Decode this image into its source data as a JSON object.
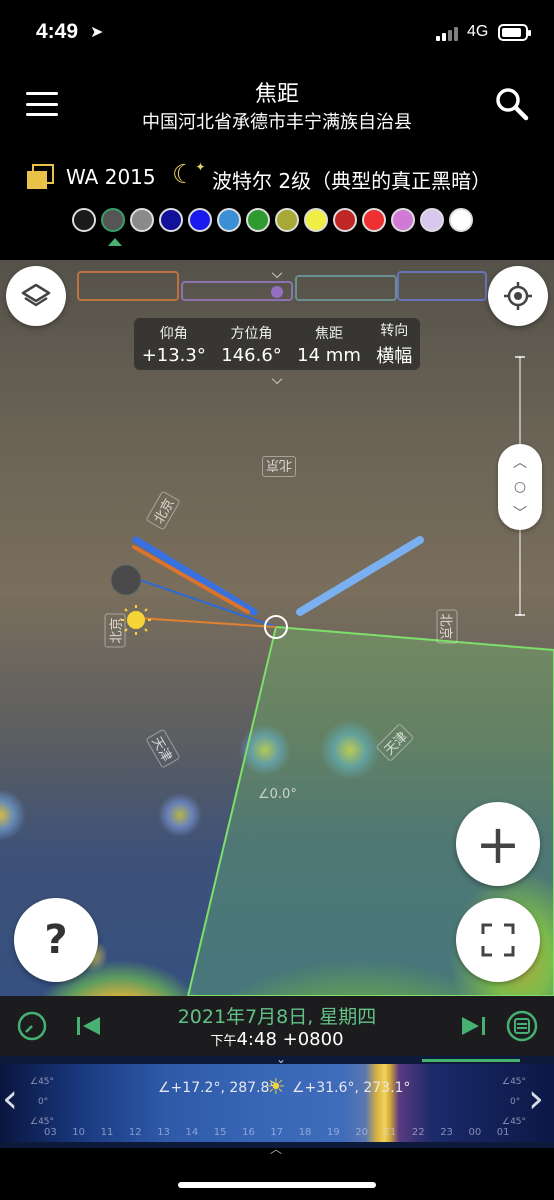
{
  "status_bar": {
    "time": "4:49",
    "network": "4G"
  },
  "header": {
    "title": "焦距",
    "subtitle": "中国河北省承德市丰宁满族自治县"
  },
  "lens": {
    "label": "WA 2015",
    "bortle": "波特尔 2级（典型的真正黑暗）"
  },
  "color_dots": [
    "#1a1a1a",
    "#555555",
    "#8a8a8a",
    "#11119a",
    "#1a1aee",
    "#3b8fd4",
    "#2f9a2f",
    "#a8a836",
    "#eeee44",
    "#c02626",
    "#ee3030",
    "#d07ad6",
    "#d8c8ee",
    "#ffffff"
  ],
  "selected_color_index": 1,
  "info_box": {
    "columns": [
      {
        "label": "仰角",
        "value": "+13.3°"
      },
      {
        "label": "方位角",
        "value": "146.6°"
      },
      {
        "label": "焦距",
        "value": "14 mm"
      },
      {
        "label": "转向",
        "value": "横幅"
      }
    ]
  },
  "map": {
    "place_labels": [
      "北京",
      "北京",
      "北京",
      "天津",
      "天津",
      "北京"
    ],
    "angle_label": "∠0.0°",
    "zoom_symbol": "+",
    "help_symbol": "?"
  },
  "date_bar": {
    "date": "2021年7月8日, 星期四",
    "pm": "下午",
    "time": "4:48 +0800"
  },
  "timeline": {
    "left_value": "∠+17.2°, 287.8°",
    "right_value": "∠+31.6°, 273.1°",
    "side_values": [
      "∠45°",
      "0°",
      "∠45°"
    ],
    "hours": [
      "03",
      "10",
      "11",
      "12",
      "13",
      "14",
      "15",
      "16",
      "17",
      "18",
      "19",
      "20",
      "21",
      "22",
      "23",
      "00",
      "01"
    ]
  },
  "icons": {
    "menu": "hamburger-icon",
    "search": "search-icon",
    "layers": "layers-icon",
    "locate": "locate-icon",
    "moon": "moon-stars-icon",
    "sun": "sun-icon"
  }
}
